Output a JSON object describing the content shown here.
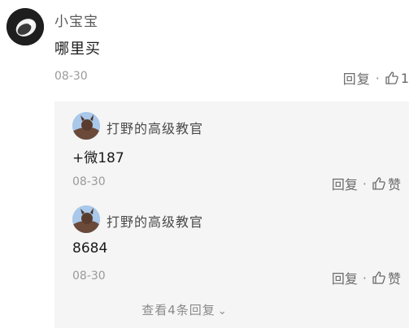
{
  "comment": {
    "username": "小宝宝",
    "text": "哪里买",
    "date": "08-30",
    "reply_label": "回复",
    "separator": "·",
    "like_count": "1",
    "avatar_icon": "profile-avatar",
    "like_icon": "thumbs-up-icon"
  },
  "replies": [
    {
      "username": "打野的高级教官",
      "text": "+微187",
      "date": "08-30",
      "reply_label": "回复",
      "separator": "·",
      "like_label": "赞"
    },
    {
      "username": "打野的高级教官",
      "text": "8684",
      "date": "08-30",
      "reply_label": "回复",
      "separator": "·",
      "like_label": "赞"
    }
  ],
  "view_more": {
    "label": "查看4条回复",
    "chevron": "⌄"
  },
  "colors": {
    "reply_bg": "#f5f5f5",
    "muted": "#9a9a9a",
    "text": "#1a1a1a"
  }
}
